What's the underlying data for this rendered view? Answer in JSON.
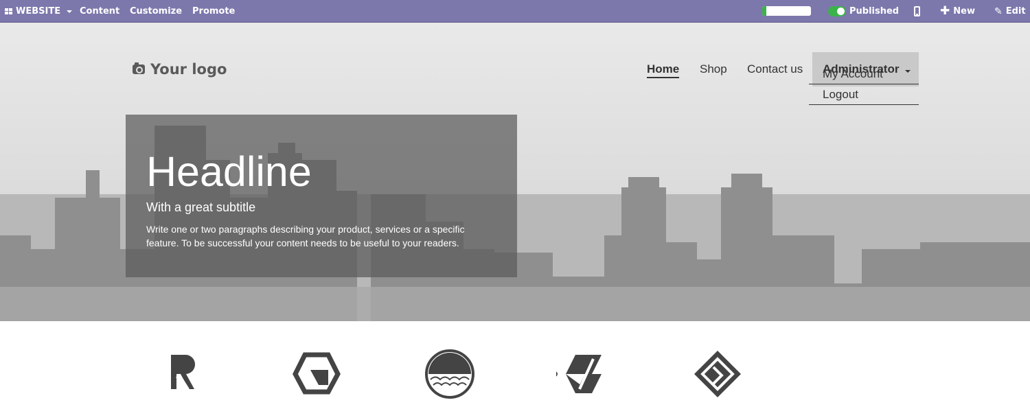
{
  "admin_bar": {
    "website_label": "WEBSITE",
    "content_label": "Content",
    "customize_label": "Customize",
    "promote_label": "Promote",
    "progress_fraction": 0.08,
    "published_label": "Published",
    "new_label": "New",
    "edit_label": "Edit"
  },
  "header": {
    "logo_text": "Your logo",
    "nav": [
      "Home",
      "Shop",
      "Contact us"
    ],
    "admin_label": "Administrator",
    "dropdown": [
      "My Account",
      "Logout"
    ]
  },
  "hero": {
    "headline": "Headline",
    "subtitle": "With a great subtitle",
    "paragraph": "Write one or two paragraphs describing your product, services or a specific feature. To be successful your content needs to be useful to your readers."
  },
  "colors": {
    "admin_bar": "#7c78ac",
    "published_toggle": "#3bb34a",
    "logo_gray": "#444444"
  },
  "logos": [
    "r-logo-icon",
    "hexagon-logo-icon",
    "circle-waves-logo-icon",
    "parallelogram-logo-icon",
    "diamond-logo-icon"
  ]
}
